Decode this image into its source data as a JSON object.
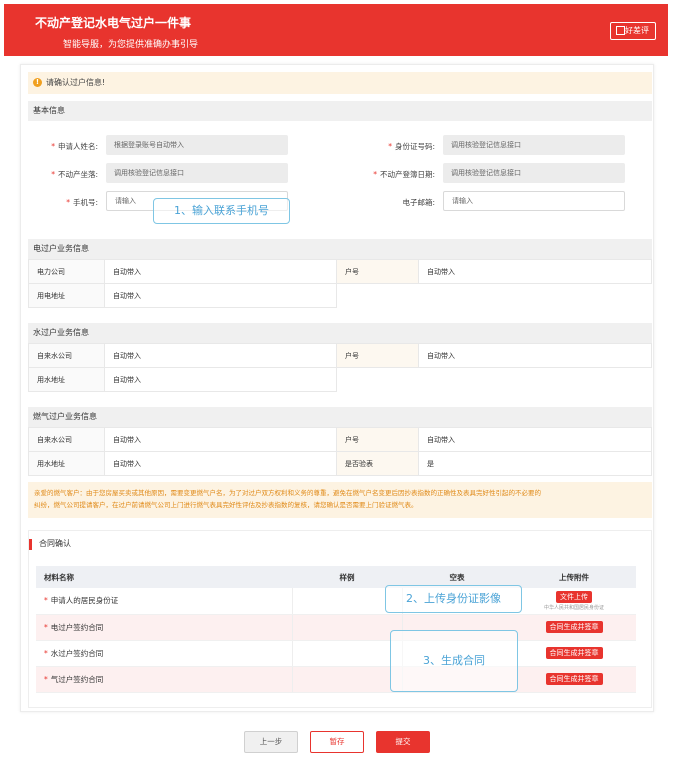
{
  "header": {
    "title": "不动产登记水电气过户一件事",
    "subtitle": "智能导服，为您提供准确办事引导",
    "rate_label": "好差评"
  },
  "alert": {
    "text": "请确认过户信息!"
  },
  "basic": {
    "section_title": "基本信息",
    "fields": {
      "applicant_name": {
        "label": "申请人姓名:",
        "value": "根据登录账号自动带入"
      },
      "id_number": {
        "label": "身份证号码:",
        "value": "调用核验登记信息接口"
      },
      "property_location": {
        "label": "不动产坐落:",
        "value": "调用核验登记信息接口"
      },
      "register_date": {
        "label": "不动产登簿日期:",
        "value": "调用核验登记信息接口"
      },
      "phone": {
        "label": "手机号:",
        "placeholder": "请输入"
      },
      "email": {
        "label": "电子邮箱:",
        "placeholder": "请输入"
      }
    }
  },
  "callouts": {
    "phone": "1、输入联系手机号",
    "upload": "2、上传身份证影像",
    "generate": "3、生成合同"
  },
  "electric": {
    "section_title": "电过户业务信息",
    "rows": [
      [
        "电力公司",
        "自动带入",
        "户号",
        "自动带入"
      ],
      [
        "用电地址",
        "自动带入"
      ]
    ]
  },
  "water": {
    "section_title": "水过户业务信息",
    "rows": [
      [
        "自来水公司",
        "自动带入",
        "户号",
        "自动带入"
      ],
      [
        "用水地址",
        "自动带入"
      ]
    ]
  },
  "gas": {
    "section_title": "燃气过户业务信息",
    "rows": [
      [
        "自来水公司",
        "自动带入",
        "户号",
        "自动带入"
      ],
      [
        "用水地址",
        "自动带入",
        "是否验表",
        "是"
      ]
    ]
  },
  "warning": {
    "line1": "亲爱的燃气客户：由于您房屋买卖或其他原因，需要变更燃气户名，为了对过户双方权利和义务的尊重，避免在燃气户名变更后因抄表指数的正确性及表具完好性引起的不必要的",
    "line2": "纠纷，燃气公司提请客户，在过户前请燃气公司上门进行燃气表具完好性评估及抄表指数的复核，请您确认是否需要上门验证燃气表。"
  },
  "contract": {
    "section_title": "合同确认",
    "columns": [
      "材料名称",
      "样例",
      "空表",
      "上传附件"
    ],
    "rows": [
      {
        "name": "申请人的居民身份证",
        "action": "文件上传",
        "hint": "中华人民共和国居民身份证"
      },
      {
        "name": "电过户签约合同",
        "action": "合同生成并签章"
      },
      {
        "name": "水过户签约合同",
        "action": "合同生成并签章"
      },
      {
        "name": "气过户签约合同",
        "action": "合同生成并签章"
      }
    ]
  },
  "buttons": {
    "prev": "上一步",
    "save": "暂存",
    "submit": "提交"
  },
  "colors": {
    "brand": "#e8342e",
    "warning_text": "#e08a18",
    "callout": "#4aa3d6"
  }
}
